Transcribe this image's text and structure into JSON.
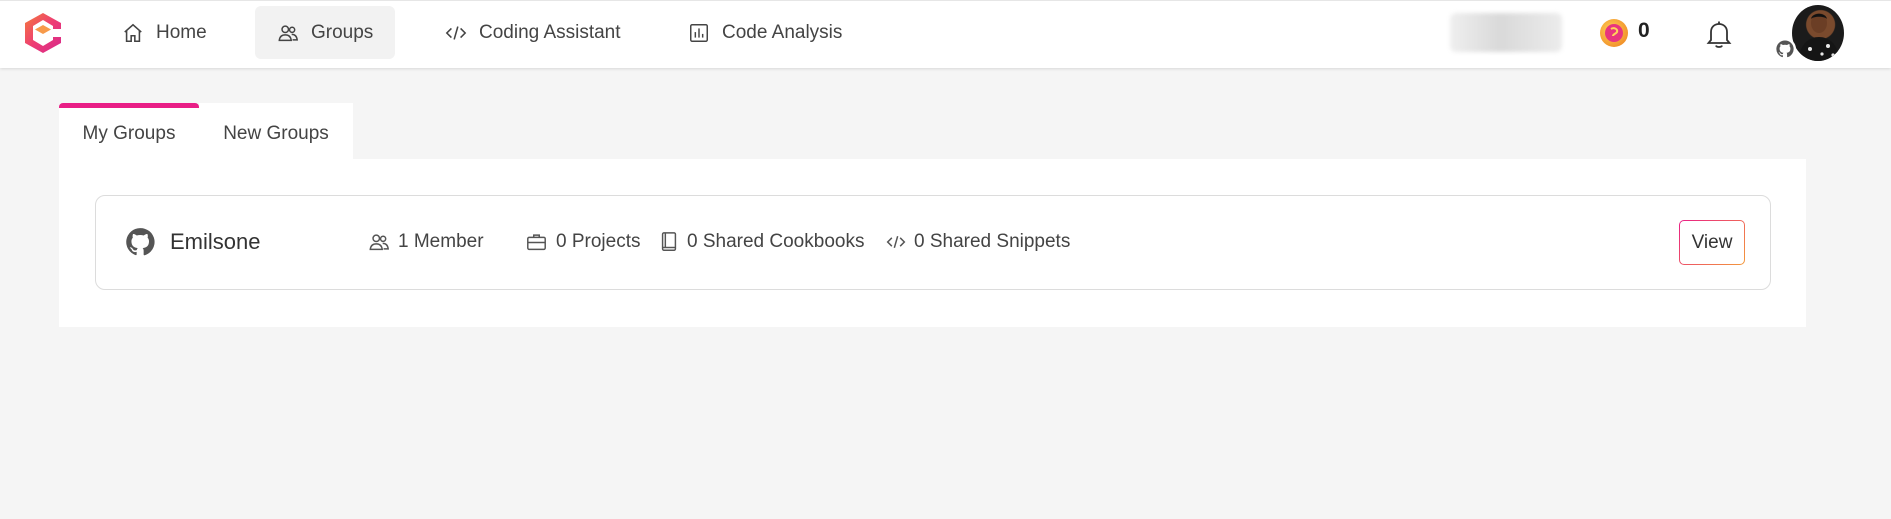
{
  "nav": {
    "items": [
      {
        "label": "Home"
      },
      {
        "label": "Groups"
      },
      {
        "label": "Coding Assistant"
      },
      {
        "label": "Code Analysis"
      }
    ]
  },
  "header": {
    "coin_count": "0"
  },
  "tabs": [
    {
      "label": "My Groups"
    },
    {
      "label": "New Groups"
    }
  ],
  "group": {
    "name": "Emilsone",
    "members": "1 Member",
    "projects": "0 Projects",
    "cookbooks": "0 Shared Cookbooks",
    "snippets": "0 Shared Snippets",
    "view_label": "View"
  },
  "colors": {
    "accent": "#e91e86",
    "accent_secondary": "#f39a3b"
  }
}
